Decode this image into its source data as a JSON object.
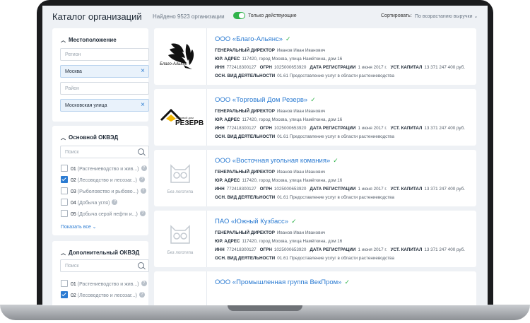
{
  "header": {
    "title": "Каталог организаций",
    "found": "Найдено 9523 организации",
    "only_active": "Только действующие",
    "sort_label": "Сортировать:",
    "sort_value": "По возрастанию выручки ⌄"
  },
  "device_label": "MacBook Pro",
  "filters": {
    "location": {
      "title": "Местоположение",
      "region_placeholder": "Регион",
      "region_value": "Москва",
      "district_placeholder": "Район",
      "street_value": "Московская улица"
    },
    "okved_main": {
      "title": "Основной ОКВЭД",
      "search_placeholder": "Поиск",
      "items": [
        {
          "code": "01",
          "desc": "(Растениеводство и жив...)",
          "checked": false
        },
        {
          "code": "02",
          "desc": "(Лесоводство и лесозаг...)",
          "checked": true
        },
        {
          "code": "03",
          "desc": "(Рыболовство и рыбово...)",
          "checked": false
        },
        {
          "code": "04",
          "desc": "(Добыча угля)",
          "checked": false
        },
        {
          "code": "05",
          "desc": "(Добыча серой нефти и...)",
          "checked": false
        }
      ],
      "show_all": "Показать все ⌄"
    },
    "okved_extra": {
      "title": "Дополнительный ОКВЭД",
      "search_placeholder": "Поиск",
      "items": [
        {
          "code": "01",
          "desc": "(Растениеводство и жив...)",
          "checked": false
        },
        {
          "code": "02",
          "desc": "(Лесоводство и лесозаг...)",
          "checked": true
        }
      ]
    }
  },
  "labels": {
    "director": "ГЕНЕРАЛЬНЫЙ ДИРЕКТОР",
    "address": "ЮР. АДРЕС",
    "inn": "ИНН",
    "ogrn": "ОГРН",
    "reg_date": "ДАТА РЕГИСТРАЦИИ",
    "capital": "УСТ. КАПИТАЛ",
    "activity": "ОСН. ВИД ДЕЯТЕЛЬНОСТИ",
    "no_logo": "Без логотипа"
  },
  "companies": [
    {
      "name": "ООО «Благо-Альянс»",
      "director": "Иванов Иван Иванович",
      "address": "117420, город Москва, улица Намёткина, дом 16",
      "inn": "772418300127",
      "ogrn": "1025000653920",
      "reg_date": "1 июня 2017 г.",
      "capital": "13 371 247 400 руб.",
      "activity": "01.61 Предоставление услуг в области растениеводства",
      "logo_text": "Благо-Альянс"
    },
    {
      "name": "ООО «Торговый Дом Резерв»",
      "director": "Иванов Иван Иванович",
      "address": "117420, город Москва, улица Намёткина, дом 16",
      "inn": "772418300127",
      "ogrn": "1025000653920",
      "reg_date": "1 июня 2017 г.",
      "capital": "13 371 247 400 руб.",
      "activity": "01.61 Предоставление услуг в области растениеводства",
      "logo_text": "РЕЗЕРВ",
      "logo_small": "Торговый дом"
    },
    {
      "name": "ООО «Восточная угольная комания»",
      "director": "Иванов Иван Иванович",
      "address": "117420, город Москва, улица Намёткина, дом 16",
      "inn": "772418300127",
      "ogrn": "1025000653920",
      "reg_date": "1 июня 2017 г.",
      "capital": "13 371 247 400 руб.",
      "activity": "01.61 Предоставление услуг в области растениеводства"
    },
    {
      "name": "ПАО «Южный Кузбасс»",
      "director": "Иванов Иван Иванович",
      "address": "117420, город Москва, улица Намёткина, дом 16",
      "inn": "772418300127",
      "ogrn": "1025000653920",
      "reg_date": "1 июня 2017 г.",
      "capital": "13 371 247 400 руб.",
      "activity": "01.61 Предоставление услуг в области растениеводства"
    },
    {
      "name": "ООО «Промышленная группа ВекПром»"
    }
  ],
  "colors": {
    "accent": "#2b7bd2",
    "success": "#2fb34a",
    "bg": "#eef1f5"
  }
}
